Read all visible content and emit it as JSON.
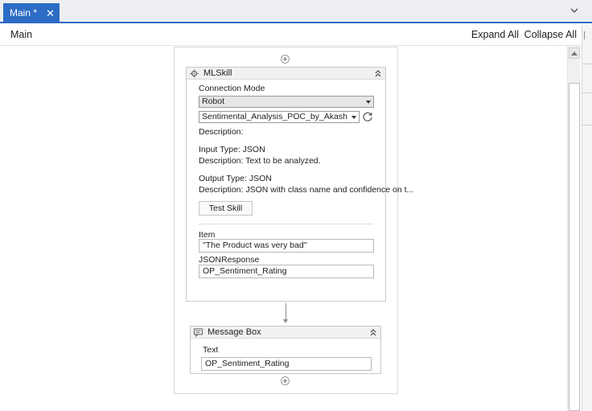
{
  "tab": {
    "label": "Main *",
    "close": "✕"
  },
  "breadcrumb": {
    "label": "Main"
  },
  "toolbar": {
    "expand_all": "Expand All",
    "collapse_all": "Collapse All"
  },
  "mlskill": {
    "title": "MLSkill",
    "connection_mode_label": "Connection Mode",
    "connection_mode_value": "Robot",
    "skill_value": "Sentimental_Analysis_POC_by_Akash",
    "description_label": "Description:",
    "input_type": "Input Type: JSON",
    "input_description": "Description: Text to be analyzed.",
    "output_type": "Output Type: JSON",
    "output_description": "Description: JSON with class name and confidence on t...",
    "test_button": "Test Skill",
    "item_label": "Item",
    "item_value": "\"The Product was very bad\"",
    "response_label": "JSONResponse",
    "response_value": "OP_Sentiment_Rating"
  },
  "messagebox": {
    "title": "Message Box",
    "text_label": "Text",
    "text_value": "OP_Sentiment_Rating"
  },
  "colors": {
    "accent": "#2b6cc4",
    "tab_text": "#ffffff"
  }
}
